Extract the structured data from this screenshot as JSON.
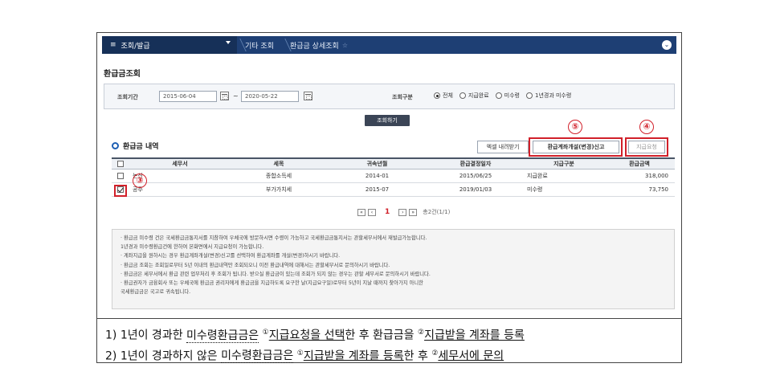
{
  "nav": {
    "menu_label": "조회/발급",
    "menu_icon": "hamburger-icon",
    "crumb1": "기타 조회",
    "crumb2": "환급금 상세조회"
  },
  "page_title": "환급금조회",
  "search": {
    "period_label": "조회기간",
    "date_from": "2015-06-04",
    "date_to": "2020-05-22",
    "tilde": "~",
    "type_label": "조회구분",
    "options": [
      "전체",
      "지급완료",
      "미수령",
      "1년경과 미수령"
    ],
    "selected": "전체",
    "button_label": "조회하기"
  },
  "results": {
    "title": "환급금 내역",
    "excel_label": "엑셀 내려받기",
    "account_label": "환급계좌개설(변경)신고",
    "request_label": "지급요청",
    "columns": [
      "세무서",
      "세목",
      "귀속년월",
      "환급결정일자",
      "지급구분",
      "환급금액"
    ],
    "rows": [
      {
        "office": "논산",
        "tax": "종합소득세",
        "period": "2014-01",
        "date": "2015/06/25",
        "status": "지급완료",
        "amount": "318,000",
        "checked": false
      },
      {
        "office": "공주",
        "tax": "부가가치세",
        "period": "2015-07",
        "date": "2019/01/03",
        "status": "미수령",
        "amount": "73,750",
        "checked": true
      }
    ],
    "page_current": "1",
    "page_total": "총2건(1/1)"
  },
  "callouts": {
    "c3": "③",
    "c4": "④",
    "c5": "⑤"
  },
  "notice": [
    "· 환급금 미수령 건은 국세환급금통지서를 지참하여 우체국에 방문하시면 수령이 가능하고 국세환급금통지서는 관할세무서에서 재발급가능합니다.",
    "  1년경과 미수령환급건에 한하여 본화면에서 지급요청이 가능합니다.",
    "· 계좌지급을 원하시는 경우 환급계좌개설(변경)신고를 선택하여 환급계좌를 개설(변경)하시기 바랍니다.",
    "· 환급금 조회는 조회일로부터 5년 이내의 환급내역만 조회되오니 이전 환급내역에 대해서는 관할세무서로 문의하시기 바랍니다.",
    "· 환급금은 세무서에서 환급 관련 업무처리 후 조회가 됩니다. 받으실 환급금이 있는데 조회가 되지 않는 경우는 관할 세무서로 문의하시기 바랍니다.",
    "· 환급권자가 금융회사 또는 우체국에 환급금 권리자에게 환급금을 지급하도록 요구한 날(지급요구일)로부터 5년이 지날 때까지 찾아가지 아니한",
    "  국세환급금은 국고로 귀속됩니다."
  ],
  "caption": {
    "line1": {
      "prefix": "1) 1년이 경과한 ",
      "u1": "미수령환급금은",
      "sp1": " ",
      "c1": "①",
      "u2": "지급요청을 선택",
      "mid": "한 후 환급금을 ",
      "c2": "②",
      "u3": "지급받을 계좌를 등록"
    },
    "line2": {
      "prefix": "2) 1년이 경과하지 않은 ",
      "u1": "미수령환급금은",
      "sp1": " ",
      "c1": "①",
      "u2": "지급받을 계좌를 등록",
      "mid": "한 후 ",
      "c2": "②",
      "u3": "세무서에 문의"
    }
  }
}
